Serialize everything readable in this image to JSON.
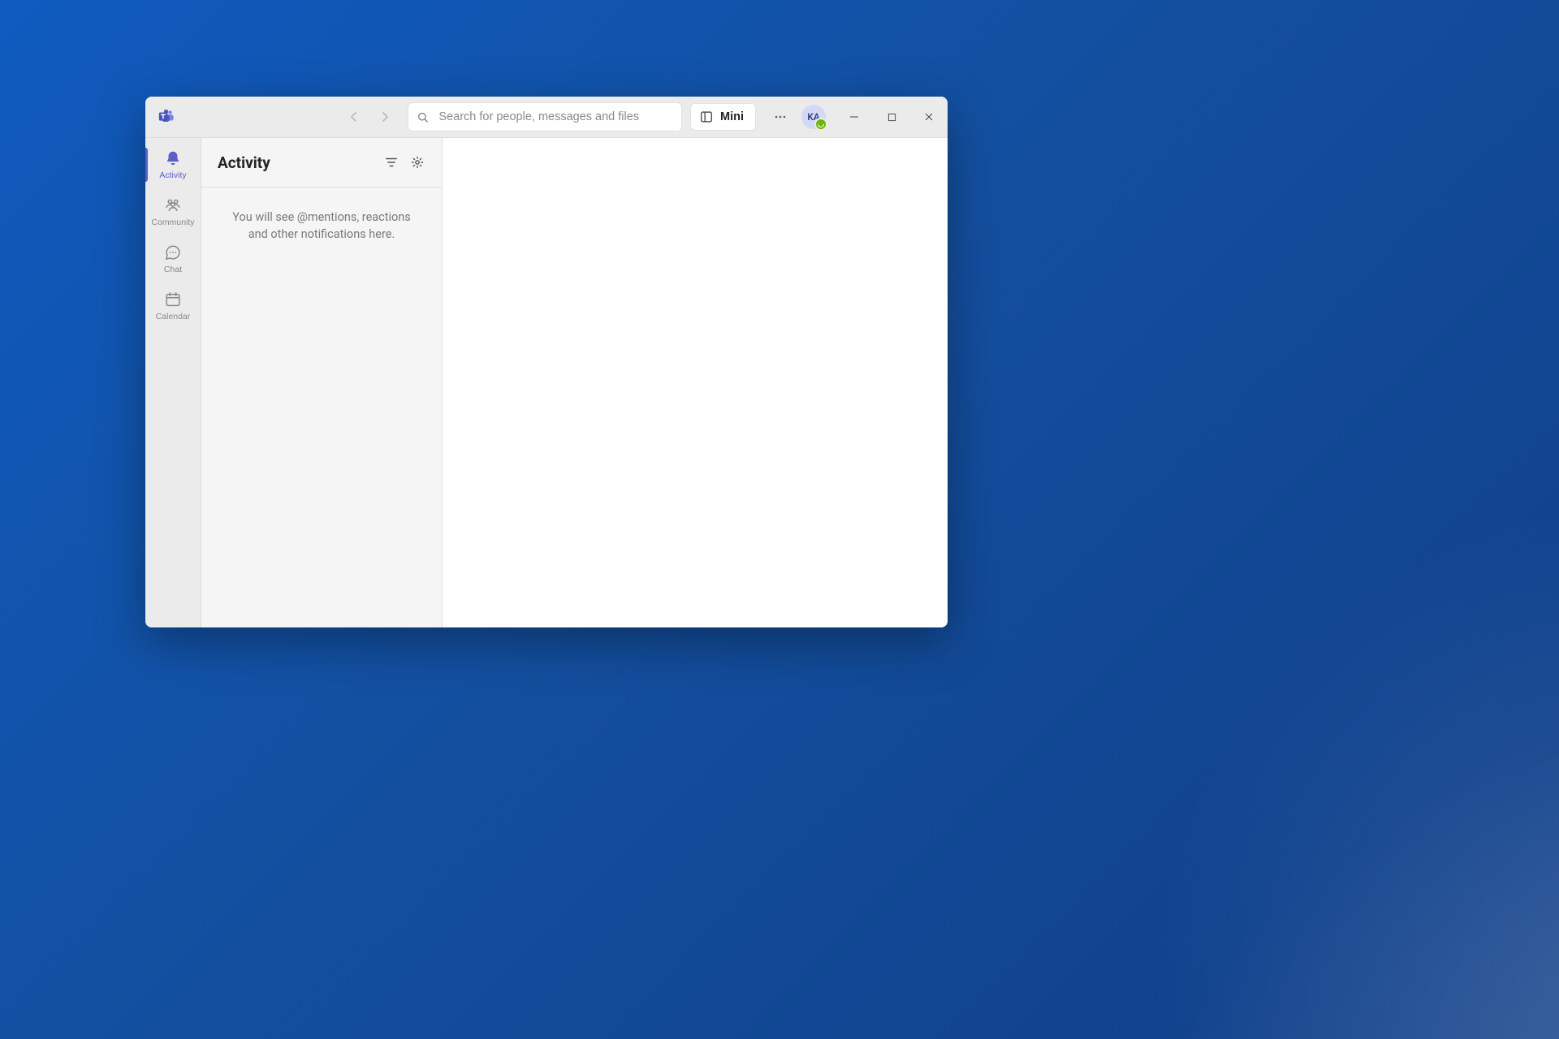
{
  "titlebar": {
    "search_placeholder": "Search for people, messages and files",
    "mini_label": "Mini",
    "avatar_initials": "KA"
  },
  "rail": {
    "items": [
      {
        "label": "Activity"
      },
      {
        "label": "Community"
      },
      {
        "label": "Chat"
      },
      {
        "label": "Calendar"
      }
    ]
  },
  "listpane": {
    "title": "Activity",
    "empty_message": "You will see @mentions, reactions and other notifications here."
  }
}
